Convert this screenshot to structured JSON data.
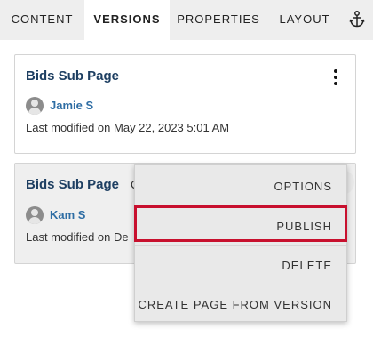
{
  "tabs": {
    "content": "CONTENT",
    "versions": "VERSIONS",
    "properties": "PROPERTIES",
    "layout": "LAYOUT",
    "active": "VERSIONS"
  },
  "versions": [
    {
      "title": "Bids Sub Page",
      "author": "Jamie S",
      "modified": "Last modified on May 22, 2023 5:01 AM"
    },
    {
      "title": "Bids Sub Page",
      "author": "Kam S",
      "modified": "Last modified on De",
      "status_fragment": "C"
    }
  ],
  "context_menu": {
    "options": "OPTIONS",
    "publish": "PUBLISH",
    "delete": "DELETE",
    "create_from_version": "CREATE PAGE FROM VERSION",
    "highlighted": "PUBLISH"
  },
  "colors": {
    "title": "#1e3f62",
    "author_link": "#2e6da4",
    "highlight": "#c8102e",
    "tabbar_bg": "#eeeeee",
    "menu_bg": "#e9e9e9"
  }
}
